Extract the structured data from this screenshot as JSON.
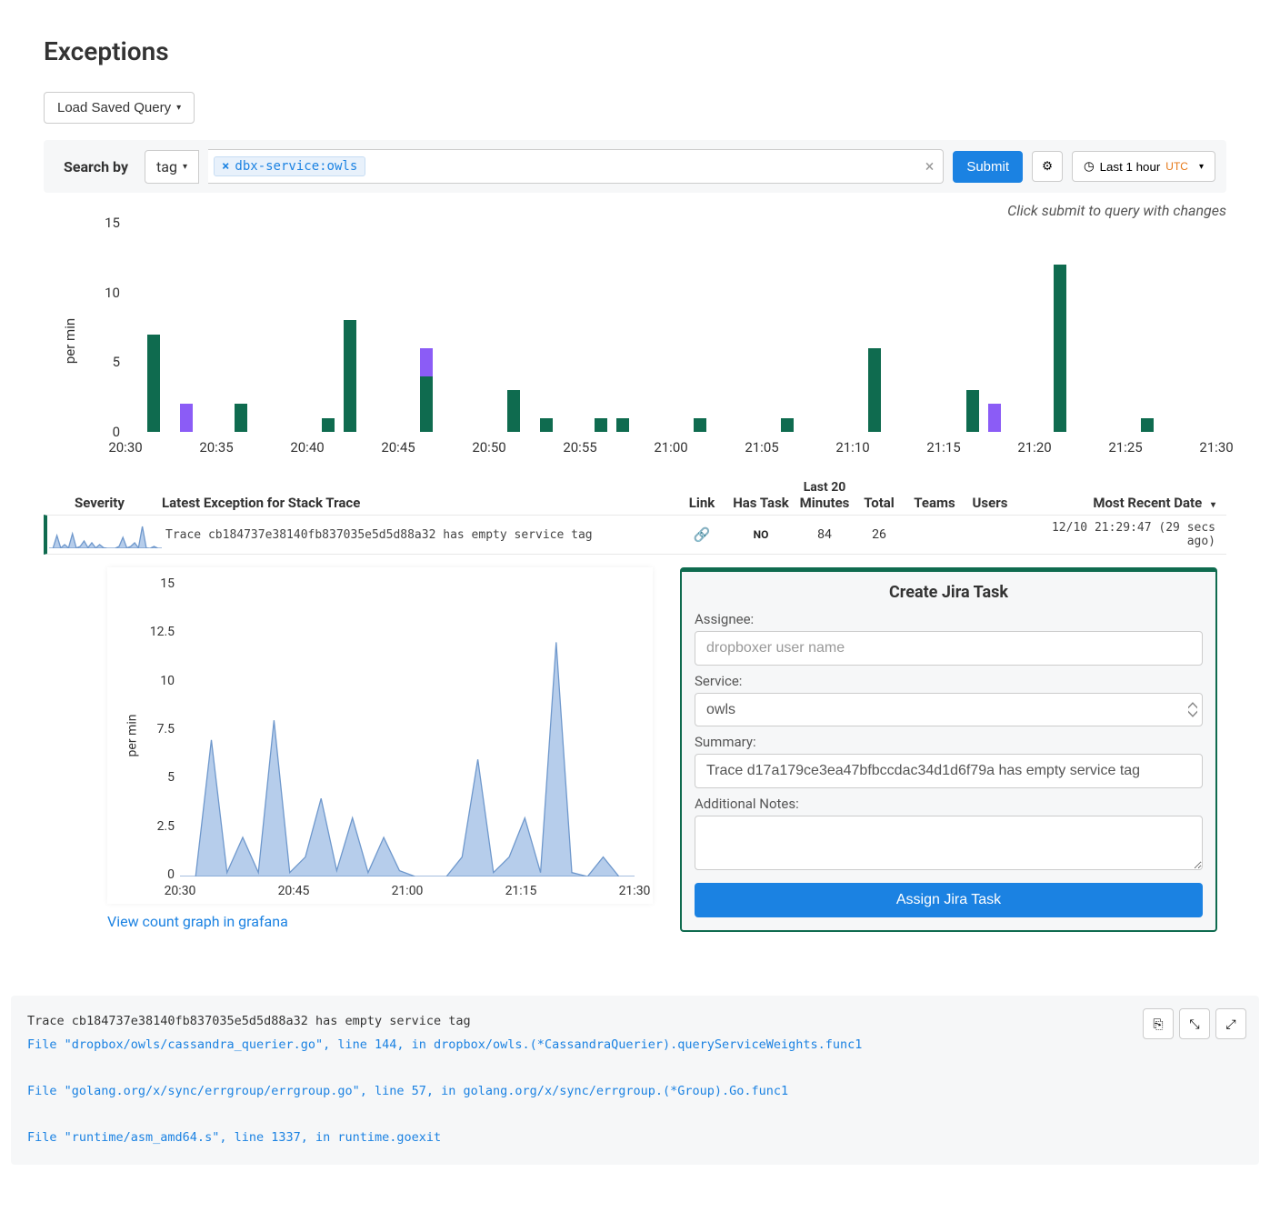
{
  "title": "Exceptions",
  "load_query_label": "Load Saved Query",
  "search": {
    "label": "Search by",
    "mode": "tag",
    "chip": "dbx-service:owls",
    "submit": "Submit",
    "time_label": "Last 1 hour",
    "tz": "UTC",
    "hint": "Click submit to query with changes"
  },
  "chart_data": {
    "type": "bar",
    "ylabel": "per min",
    "yticks": [
      0,
      5,
      10,
      15
    ],
    "ylim": [
      0,
      15
    ],
    "x_categories": [
      "20:30",
      "20:35",
      "20:40",
      "20:45",
      "20:50",
      "20:55",
      "21:00",
      "21:05",
      "21:10",
      "21:15",
      "21:20",
      "21:25",
      "21:30"
    ],
    "series": [
      {
        "name": "green",
        "color": "#0f6b4f"
      },
      {
        "name": "purple",
        "color": "#8b5cf6"
      }
    ],
    "bars": [
      {
        "x": 20.52,
        "h": 7,
        "s": "green"
      },
      {
        "x": 20.55,
        "h": 2,
        "s": "purple"
      },
      {
        "x": 20.6,
        "h": 2,
        "s": "green"
      },
      {
        "x": 20.68,
        "h": 1,
        "s": "green"
      },
      {
        "x": 20.7,
        "h": 8,
        "s": "green"
      },
      {
        "x": 20.77,
        "h": 4,
        "s": "green"
      },
      {
        "x": 20.77,
        "h": 6,
        "s": "purple",
        "stackTop": true
      },
      {
        "x": 20.85,
        "h": 3,
        "s": "green"
      },
      {
        "x": 20.88,
        "h": 1,
        "s": "green"
      },
      {
        "x": 20.93,
        "h": 1,
        "s": "green"
      },
      {
        "x": 20.95,
        "h": 1,
        "s": "green"
      },
      {
        "x": 21.02,
        "h": 1,
        "s": "green"
      },
      {
        "x": 21.1,
        "h": 1,
        "s": "green"
      },
      {
        "x": 21.18,
        "h": 6,
        "s": "green"
      },
      {
        "x": 21.27,
        "h": 3,
        "s": "green"
      },
      {
        "x": 21.29,
        "h": 2,
        "s": "purple"
      },
      {
        "x": 21.35,
        "h": 12,
        "s": "green"
      },
      {
        "x": 21.43,
        "h": 1,
        "s": "green"
      }
    ]
  },
  "columns": {
    "severity": "Severity",
    "latest": "Latest Exception for Stack Trace",
    "link": "Link",
    "has_task": "Has Task",
    "last20": "Last 20",
    "minutes": "Minutes",
    "total": "Total",
    "teams": "Teams",
    "users": "Users",
    "recent": "Most Recent Date"
  },
  "row": {
    "message": "Trace cb184737e38140fb837035e5d5d88a32 has empty service tag",
    "has_task": "NO",
    "last20": "84",
    "total": "26",
    "date": "12/10 21:29:47 (29 secs ago)"
  },
  "mini_chart": {
    "type": "area",
    "ylabel": "per min",
    "yticks": [
      0,
      2.5,
      5,
      7.5,
      10,
      12.5,
      15
    ],
    "ylim": [
      0,
      15
    ],
    "x_categories": [
      "20:30",
      "20:45",
      "21:00",
      "21:15",
      "21:30"
    ],
    "values": [
      0,
      0,
      7,
      0.2,
      2,
      0.2,
      8,
      0.2,
      1,
      4,
      0.3,
      3,
      0.2,
      2,
      0.3,
      0,
      0,
      0,
      1,
      6,
      0.2,
      1,
      3,
      0.2,
      12,
      0.2,
      0,
      1,
      0,
      0
    ]
  },
  "grafana_link": "View count graph in grafana",
  "jira": {
    "title": "Create Jira Task",
    "assignee_label": "Assignee:",
    "assignee_placeholder": "dropboxer user name",
    "service_label": "Service:",
    "service_value": "owls",
    "summary_label": "Summary:",
    "summary_value": "Trace d17a179ce3ea47bfbccdac34d1d6f79a has empty service tag",
    "notes_label": "Additional Notes:",
    "assign_btn": "Assign Jira Task"
  },
  "stack": {
    "line1": "Trace cb184737e38140fb837035e5d5d88a32 has empty service tag",
    "file1": "File \"dropbox/owls/cassandra_querier.go\", line 144, in dropbox/owls.(*CassandraQuerier).queryServiceWeights.func1",
    "file2": "File \"golang.org/x/sync/errgroup/errgroup.go\", line 57, in golang.org/x/sync/errgroup.(*Group).Go.func1",
    "file3": "File \"runtime/asm_amd64.s\", line 1337, in runtime.goexit"
  }
}
